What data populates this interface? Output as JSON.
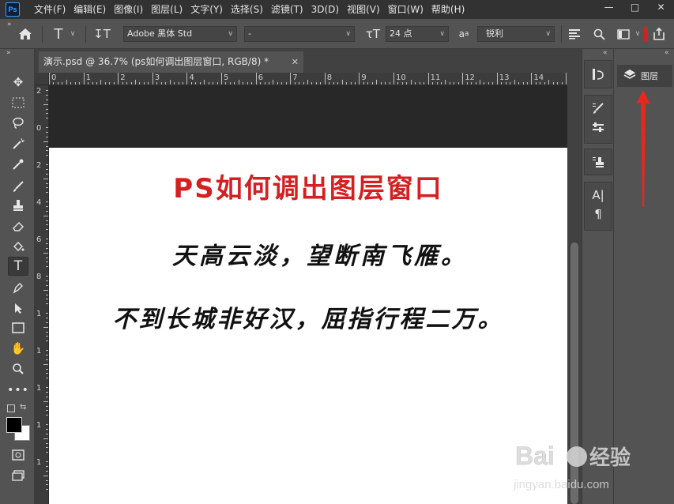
{
  "menubar": {
    "logo": "Ps",
    "items": [
      "文件(F)",
      "编辑(E)",
      "图像(I)",
      "图层(L)",
      "文字(Y)",
      "选择(S)",
      "滤镜(T)",
      "3D(D)",
      "视图(V)",
      "窗口(W)",
      "帮助(H)"
    ],
    "controls": [
      "minimize",
      "restore",
      "close"
    ]
  },
  "optbar": {
    "font_family": "Adobe 黑体 Std",
    "font_style": "-",
    "font_size": "24 点",
    "aa_label": "a",
    "antialias": "锐利"
  },
  "tools": [
    "move-icon",
    "marquee-icon",
    "lasso-icon",
    "magic-wand-icon",
    "eyedropper-icon",
    "brush-icon",
    "clone-stamp-icon",
    "eraser-icon",
    "paint-bucket-icon",
    "type-icon",
    "pen-icon",
    "path-selection-icon",
    "rectangle-icon",
    "hand-icon",
    "zoom-icon",
    "more-icon"
  ],
  "document": {
    "tab_title": "演示.psd @ 36.7% (ps如何调出图层窗口, RGB/8) *",
    "title_text": "PS如何调出图层窗口",
    "poem_line1": "天高云淡，望断南飞雁。",
    "poem_line2": "不到长城非好汉，屈指行程二万。"
  },
  "ruler": {
    "h_labels": [
      "0",
      "1",
      "2",
      "3",
      "4",
      "5",
      "6",
      "7",
      "8",
      "9",
      "10",
      "11",
      "12",
      "13",
      "14",
      "1"
    ],
    "v_labels": [
      "2",
      "0",
      "2",
      "4",
      "6",
      "8",
      "1",
      "1",
      "1",
      "1",
      "1"
    ]
  },
  "panels": {
    "layers_label": "图层"
  },
  "colors": {
    "accent_red": "#d42020",
    "canvas_bg": "#ffffff",
    "ui_bg": "#535353"
  },
  "watermark": {
    "brand": "Bai",
    "brand2": "经验",
    "url": "jingyan.baidu.com"
  }
}
